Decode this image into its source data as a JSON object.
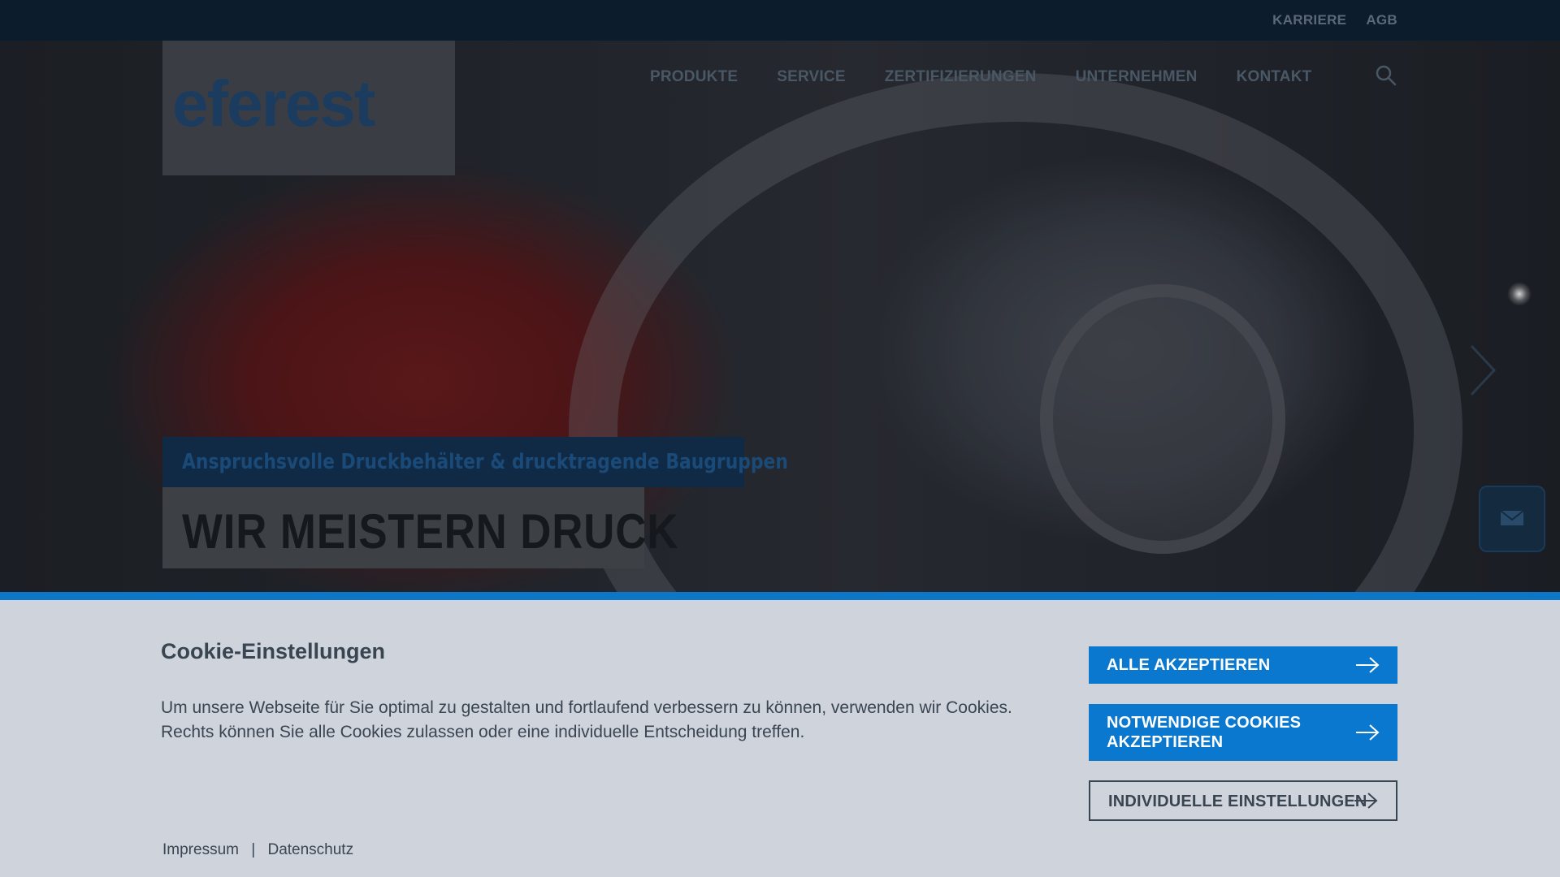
{
  "topbar": {
    "links": [
      "KARRIERE",
      "AGB"
    ]
  },
  "brand": {
    "logo_text": "eferest"
  },
  "nav": {
    "items": [
      "PRODUKTE",
      "SERVICE",
      "ZERTIFIZIERUNGEN",
      "UNTERNEHMEN",
      "KONTAKT"
    ],
    "search_icon": "search-icon"
  },
  "hero": {
    "subtitle": "Anspruchsvolle Druckbehälter & drucktragende Baugruppen",
    "title": "WIR MEISTERN DRUCK",
    "next_icon": "chevron-right-icon",
    "contact_icon": "envelope-icon"
  },
  "cookie": {
    "title": "Cookie-Einstellungen",
    "text_line1": "Um unsere Webseite für Sie optimal zu gestalten und fortlaufend verbessern zu können, verwenden wir Cookies.",
    "text_line2": "Rechts können Sie alle Cookies zulassen oder eine individuelle Entscheidung treffen.",
    "buttons": {
      "accept_all": "ALLE AKZEPTIEREN",
      "accept_necessary": "NOTWENDIGE COOKIES AKZEPTIEREN",
      "individual": "INDIVIDUELLE EINSTELLUNGEN"
    },
    "links": {
      "imprint": "Impressum",
      "separator": "|",
      "privacy": "Datenschutz"
    }
  },
  "colors": {
    "accent": "#0b78d0",
    "panel_bg": "#cfd3dc",
    "text": "#3a4552",
    "topbar": "#0c1c2c"
  }
}
